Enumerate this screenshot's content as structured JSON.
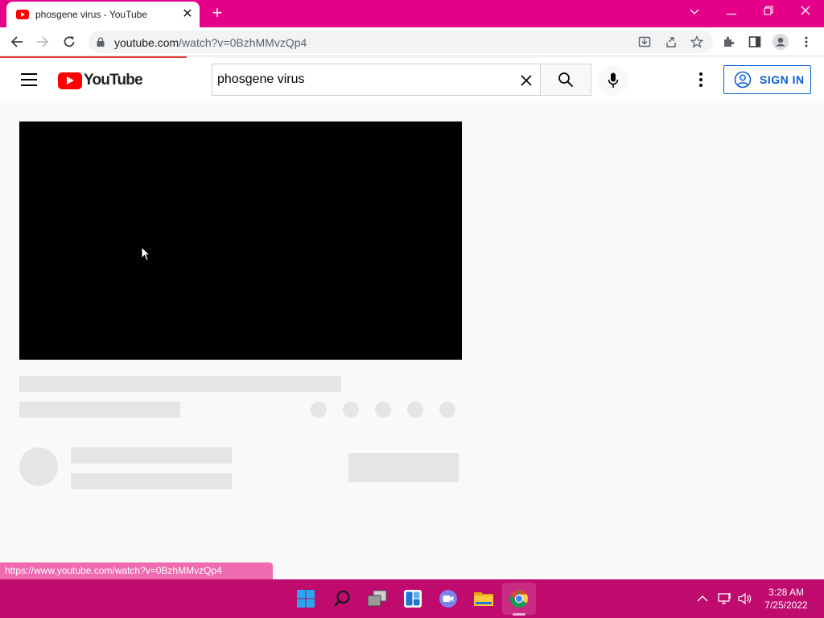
{
  "browser": {
    "tab_title": "phosgene virus - YouTube",
    "url_host": "youtube.com",
    "url_path": "/watch?v=0BzhMMvzQp4",
    "new_tab_label": "+",
    "status_url": "https://www.youtube.com/watch?v=0BzhMMvzQp4"
  },
  "youtube": {
    "logo_text": "YouTube",
    "search_query": "phosgene virus",
    "sign_in_label": "SIGN IN"
  },
  "player": {
    "state": "loading"
  },
  "colors": {
    "titlebar": "#e5008a",
    "taskbar": "#bf0a6e",
    "youtube_red": "#ff0000",
    "signin_blue": "#065fd4"
  },
  "taskbar": {
    "apps": [
      "start-icon",
      "search-icon",
      "task-view-icon",
      "widgets-icon",
      "chat-icon",
      "file-explorer-icon",
      "chrome-icon"
    ],
    "time": "3:28 AM",
    "date": "7/25/2022"
  }
}
